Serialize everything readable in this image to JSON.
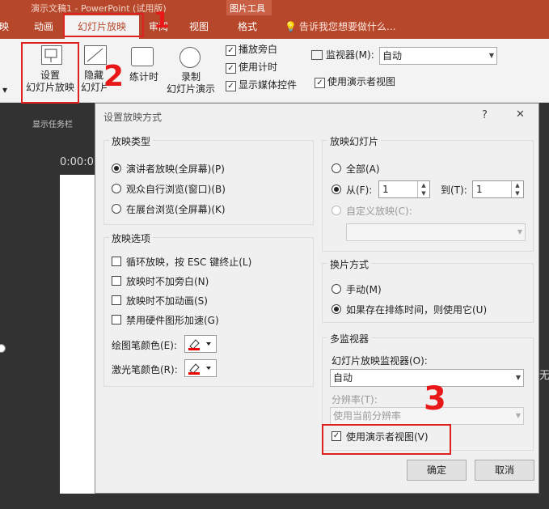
{
  "window": {
    "title": "演示文稿1 - PowerPoint (试用版)",
    "context_group": "图片工具"
  },
  "tabs": [
    {
      "label": "映"
    },
    {
      "label": "动画"
    },
    {
      "label": "幻灯片放映"
    },
    {
      "label": "审阅"
    },
    {
      "label": "视图"
    },
    {
      "label": "格式"
    }
  ],
  "tellme": "告诉我您想要做什么...",
  "ribbon": {
    "left_partial": "映",
    "setup_show": "设置\n幻灯片放映",
    "hide_slide": "隐藏\n幻灯片",
    "rehearse": "练计时",
    "record": "录制\n幻灯片演示",
    "play_narration": "播放旁白",
    "use_timings": "使用计时",
    "show_media_controls": "显示媒体控件",
    "monitor_label": "监视器(M):",
    "monitor_value": "自动",
    "use_presenter_view": "使用演示者视图"
  },
  "editor": {
    "task_pane": "显示任务栏",
    "time": "0:00:0",
    "right_char": "无"
  },
  "dialog": {
    "title": "设置放映方式",
    "help": "?",
    "close": "✕",
    "show_type": {
      "title": "放映类型",
      "options": [
        "演讲者放映(全屏幕)(P)",
        "观众自行浏览(窗口)(B)",
        "在展台浏览(全屏幕)(K)"
      ],
      "selected": 0
    },
    "show_options": {
      "title": "放映选项",
      "items": [
        "循环放映，按 ESC 键终止(L)",
        "放映时不加旁白(N)",
        "放映时不加动画(S)",
        "禁用硬件图形加速(G)"
      ],
      "pen_color": "绘图笔颜色(E):",
      "laser_color": "激光笔颜色(R):"
    },
    "show_slides": {
      "title": "放映幻灯片",
      "all": "全部(A)",
      "from": "从(F):",
      "from_value": "1",
      "to": "到(T):",
      "to_value": "1",
      "custom": "自定义放映(C):",
      "selected": "from"
    },
    "advance": {
      "title": "换片方式",
      "manual": "手动(M)",
      "timings": "如果存在排练时间，则使用它(U)",
      "selected": "timings"
    },
    "multi_monitor": {
      "title": "多监视器",
      "monitor_label": "幻灯片放映监视器(O):",
      "monitor_value": "自动",
      "resolution_label": "分辨率(T):",
      "resolution_value": "使用当前分辨率",
      "presenter_view": "使用演示者视图(V)"
    },
    "ok": "确定",
    "cancel": "取消"
  },
  "annotations": [
    "1",
    "2",
    "3"
  ],
  "colors": {
    "accent": "#b7472a",
    "annotation": "#e02020"
  }
}
